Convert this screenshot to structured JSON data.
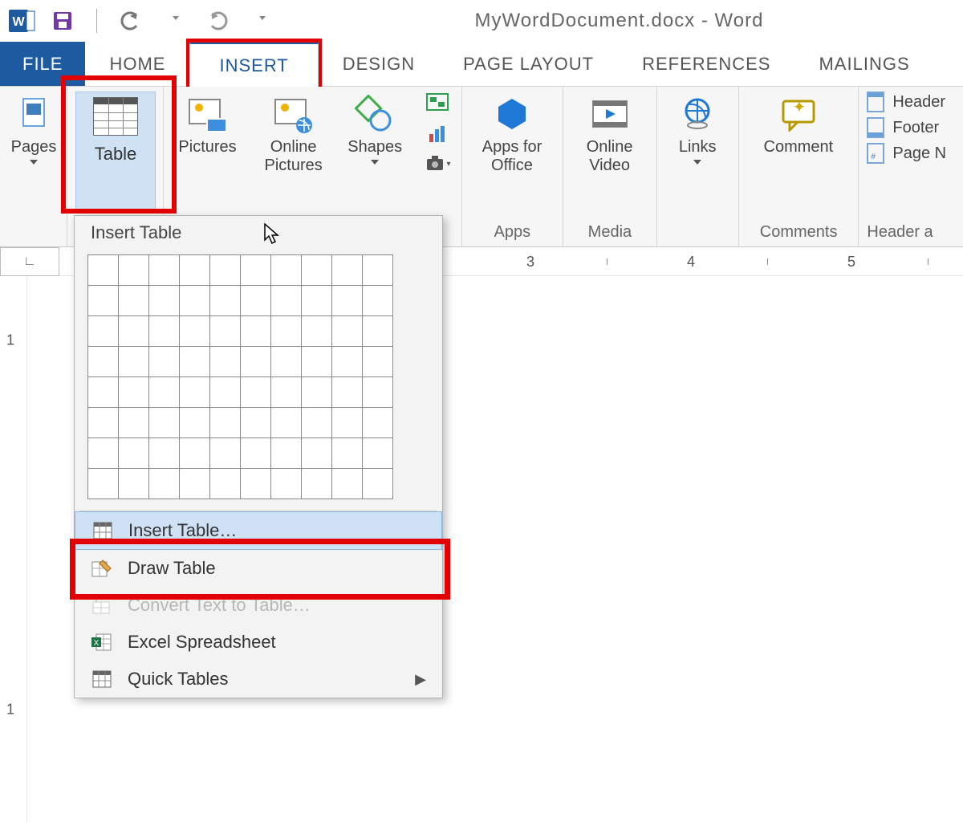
{
  "app": {
    "title": "MyWordDocument.docx - Word"
  },
  "tabs": {
    "file": "FILE",
    "home": "HOME",
    "insert": "INSERT",
    "design": "DESIGN",
    "page_layout": "PAGE LAYOUT",
    "references": "REFERENCES",
    "mailings": "MAILINGS"
  },
  "ribbon": {
    "pages_label": "Pages",
    "table_label": "Table",
    "pictures_label": "Pictures",
    "online_pictures_label": "Online\nPictures",
    "shapes_label": "Shapes",
    "apps_label": "Apps for\nOffice",
    "apps_group": "Apps",
    "video_label": "Online\nVideo",
    "media_group": "Media",
    "links_label": "Links",
    "comment_label": "Comment",
    "comments_group": "Comments",
    "header_label": "Header",
    "footer_label": "Footer",
    "page_number_label": "Page N",
    "hf_group": "Header a"
  },
  "ruler": {
    "3": "3",
    "4": "4",
    "5": "5",
    "v1_top": "1",
    "v1_bot": "1"
  },
  "dropdown": {
    "title": "Insert Table",
    "items": {
      "insert_table": "Insert Table…",
      "draw_table": "Draw Table",
      "convert": "Convert Text to Table…",
      "excel": "Excel Spreadsheet",
      "quick": "Quick Tables"
    }
  }
}
